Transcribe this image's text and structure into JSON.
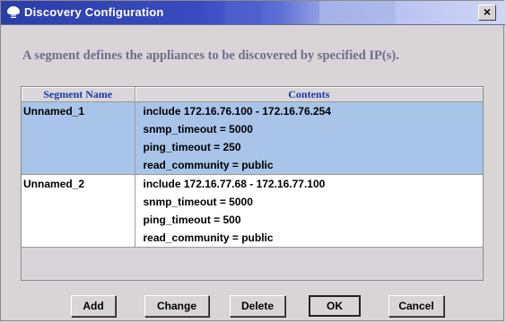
{
  "window": {
    "title": "Discovery Configuration",
    "close_label": "×",
    "description": "A segment defines the appliances to be discovered by specified IP(s)."
  },
  "table": {
    "columns": [
      "Segment Name",
      "Contents"
    ],
    "rows": [
      {
        "name": "Unnamed_1",
        "selected": true,
        "contents": [
          "include 172.16.76.100 - 172.16.76.254",
          "snmp_timeout = 5000",
          "ping_timeout = 250",
          "read_community = public"
        ]
      },
      {
        "name": "Unnamed_2",
        "selected": false,
        "contents": [
          "include 172.16.77.68 - 172.16.77.100",
          "snmp_timeout = 5000",
          "ping_timeout = 500",
          "read_community = public"
        ]
      }
    ]
  },
  "buttons": {
    "add": "Add",
    "change": "Change",
    "delete": "Delete",
    "ok": "OK",
    "cancel": "Cancel"
  },
  "colors": {
    "title_bar": "#2a3ea8",
    "selection": "#a8c4e8",
    "header_text": "#1e36a8",
    "description_text": "#6d6d8e"
  },
  "icons": {
    "title": "app-logo-icon"
  }
}
